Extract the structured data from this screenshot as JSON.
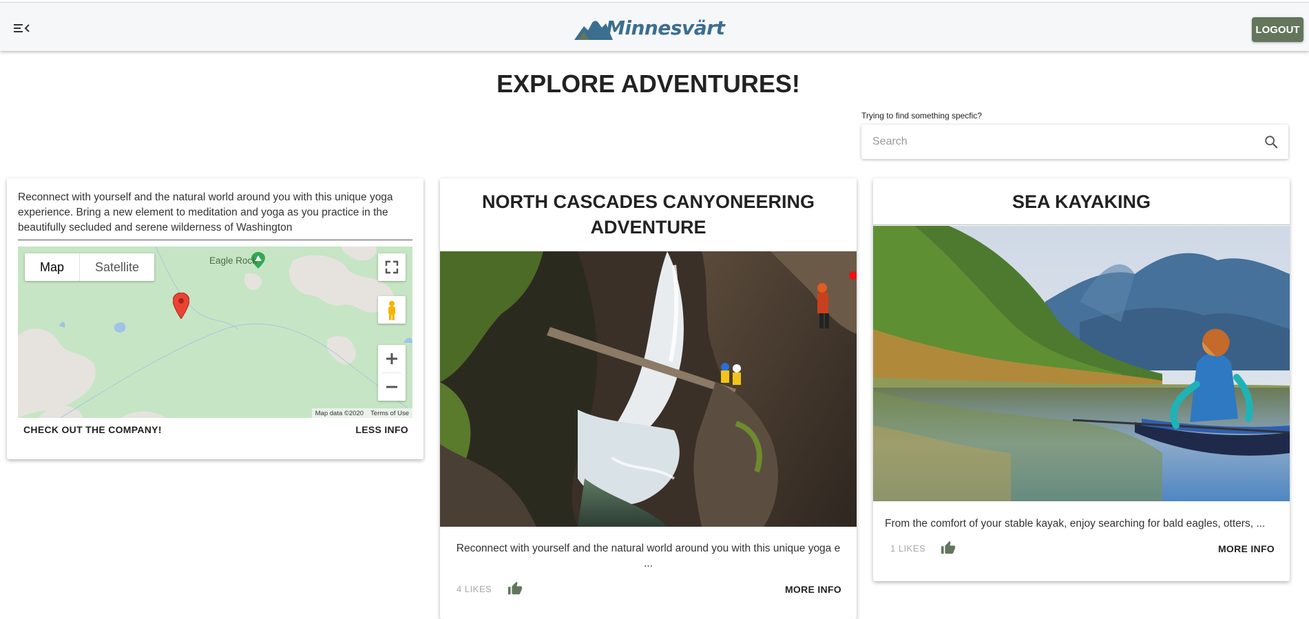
{
  "header": {
    "menu_icon": "menu-collapse-icon",
    "logo_text": "Minnesvärt",
    "logout_label": "LOGOUT",
    "colors": {
      "bar": "#f6f7f9",
      "logout": "#63765c",
      "logo": "#3b6e8f"
    }
  },
  "main": {
    "title": "EXPLORE ADVENTURES!",
    "search": {
      "hint": "Trying to find something specfic?",
      "placeholder": "Search",
      "value": ""
    }
  },
  "cards": [
    {
      "state": "expanded",
      "description": "Reconnect with yourself and the natural world around you with this unique yoga experience. Bring a new element to meditation and yoga as you practice in the beautifully secluded and serene wilderness of Washington",
      "map": {
        "type_options": [
          "Map",
          "Satellite"
        ],
        "selected_type": "Map",
        "place_label": "Eagle Rock",
        "data_credit": "Map data ©2020",
        "terms": "Terms of Use",
        "zoom_in": "+",
        "zoom_out": "−"
      },
      "company_button": "CHECK OUT THE COMPANY!",
      "toggle_button": "LESS INFO"
    },
    {
      "state": "collapsed",
      "title": "NORTH CASCADES CANYONEERING ADVENTURE",
      "excerpt": "Reconnect with yourself and the natural world around you with this unique yoga e ...",
      "likes": "4 LIKES",
      "more_button": "MORE INFO"
    },
    {
      "state": "collapsed",
      "title": "SEA KAYAKING",
      "excerpt": "From the comfort of your stable kayak, enjoy searching for bald eagles, otters, ...",
      "likes": "1 LIKES",
      "more_button": "MORE INFO"
    }
  ],
  "icons": {
    "like": "thumb-up-icon",
    "search": "search-icon",
    "map_pin": "map-marker-icon"
  },
  "accent_like_color": "#63765c"
}
